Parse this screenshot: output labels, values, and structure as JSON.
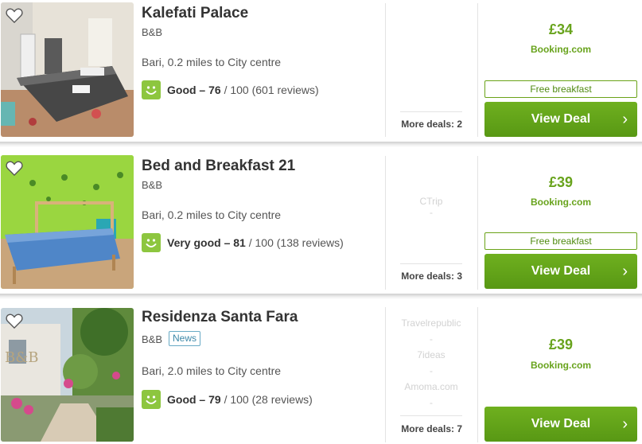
{
  "hotels": [
    {
      "name": "Kalefati Palace",
      "type": "B&B",
      "location": "Bari, 0.2 miles to City centre",
      "rating_label": "Good – 76",
      "rating_rest": " / 100 (601 reviews)",
      "other_sites": [],
      "more_deals": "More deals: 2",
      "price": "£34",
      "provider": "Booking.com",
      "perk": "Free breakfast",
      "cta": "View Deal"
    },
    {
      "name": "Bed and Breakfast 21",
      "type": "B&B",
      "location": "Bari, 0.2 miles to City centre",
      "rating_label": "Very good – 81",
      "rating_rest": " / 100 (138 reviews)",
      "other_sites": [
        "CTrip",
        "-"
      ],
      "more_deals": "More deals: 3",
      "price": "£39",
      "provider": "Booking.com",
      "perk": "Free breakfast",
      "cta": "View Deal"
    },
    {
      "name": "Residenza Santa Fara",
      "type": "B&B",
      "badge": "News",
      "location": "Bari, 2.0 miles to City centre",
      "rating_label": "Good – 79",
      "rating_rest": " / 100 (28 reviews)",
      "other_sites": [
        "Travelrepublic",
        "-",
        "7ideas",
        "-",
        "Amoma.com",
        "-"
      ],
      "more_deals": "More deals: 7",
      "price": "£39",
      "provider": "Booking.com",
      "cta": "View Deal"
    }
  ],
  "icons": {
    "favorite": "heart-icon",
    "rating": "smiley-icon",
    "chevron": "chevron-right-icon"
  },
  "colors": {
    "accent_green": "#68a31c",
    "button_green": "#5fa016",
    "rating_green": "#8dc63f",
    "badge_blue": "#3d88a8"
  }
}
